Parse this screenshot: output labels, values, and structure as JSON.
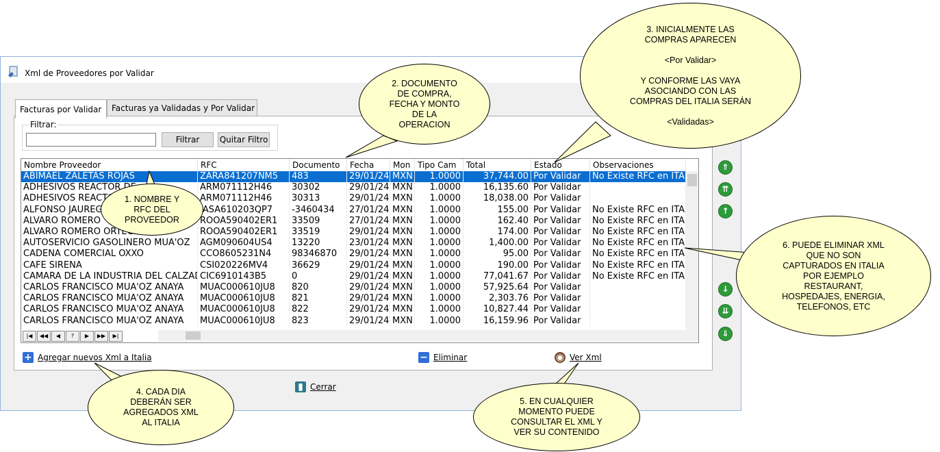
{
  "window": {
    "title": "Xml de Proveedores por Validar"
  },
  "tabs": [
    "Facturas por Validar",
    "Facturas ya Validadas y Por Validar"
  ],
  "filter": {
    "label": "Filtrar:",
    "value": "",
    "filter_btn": "Filtrar",
    "clear_btn": "Quitar Filtro"
  },
  "grid": {
    "columns": [
      "Nombre Proveedor",
      "RFC",
      "Documento",
      "Fecha",
      "Mon",
      "Tipo Cam",
      "Total",
      "Estado",
      "Observaciones"
    ],
    "rows": [
      [
        "ABIMAEL ZALETAS ROJAS",
        "ZARA841207NM5",
        "483",
        "29/01/24",
        "MXN",
        "1.0000",
        "37,744.00",
        "Por Validar",
        "No Existe RFC en ITA"
      ],
      [
        "ADHESIVOS REACTOR DE",
        "ARM071112H46",
        "30302",
        "29/01/24",
        "MXN",
        "1.0000",
        "16,135.60",
        "Por Validar",
        ""
      ],
      [
        "ADHESIVOS REACTOR",
        "ARM071112H46",
        "30313",
        "29/01/24",
        "MXN",
        "1.0000",
        "18,038.00",
        "Por Validar",
        ""
      ],
      [
        "ALFONSO JAUREGUI",
        "IASA610203QP7",
        "-3460434",
        "27/01/24",
        "MXN",
        "1.0000",
        "155.00",
        "Por Validar",
        "No Existe RFC en ITA"
      ],
      [
        "ALVARO ROMERO",
        "ROOA590402ER1",
        "33509",
        "27/01/24",
        "MXN",
        "1.0000",
        "162.40",
        "Por Validar",
        "No Existe RFC en ITA"
      ],
      [
        "ALVARO ROMERO ORTEGA",
        "ROOA590402ER1",
        "33519",
        "29/01/24",
        "MXN",
        "1.0000",
        "174.00",
        "Por Validar",
        "No Existe RFC en ITA"
      ],
      [
        "AUTOSERVICIO GASOLINERO MUÃ'OZ",
        "AGM090604US4",
        "13220",
        "23/01/24",
        "MXN",
        "1.0000",
        "1,400.00",
        "Por Validar",
        "No Existe RFC en ITA"
      ],
      [
        "CADENA COMERCIAL OXXO",
        "CCO8605231N4",
        "98346870",
        "29/01/24",
        "MXN",
        "1.0000",
        "95.00",
        "Por Validar",
        "No Existe RFC en ITA"
      ],
      [
        "CAFE SIRENA",
        "CSI020226MV4",
        "36629",
        "29/01/24",
        "MXN",
        "1.0000",
        "190.00",
        "Por Validar",
        "No Existe RFC en ITA"
      ],
      [
        "CAMARA DE LA INDUSTRIA DEL CALZADO",
        "CIC6910143B5",
        "0",
        "29/01/24",
        "MXN",
        "1.0000",
        "77,041.67",
        "Por Validar",
        "No Existe RFC en ITA"
      ],
      [
        "CARLOS FRANCISCO MUÃ'OZ ANAYA",
        "MUAC000610JU8",
        "820",
        "29/01/24",
        "MXN",
        "1.0000",
        "57,925.64",
        "Por Validar",
        ""
      ],
      [
        "CARLOS FRANCISCO MUÃ'OZ ANAYA",
        "MUAC000610JU8",
        "821",
        "29/01/24",
        "MXN",
        "1.0000",
        "2,303.76",
        "Por Validar",
        ""
      ],
      [
        "CARLOS FRANCISCO MUÃ'OZ ANAYA",
        "MUAC000610JU8",
        "822",
        "29/01/24",
        "MXN",
        "1.0000",
        "10,827.44",
        "Por Validar",
        ""
      ],
      [
        "CARLOS FRANCISCO MUÃ'OZ ANAYA",
        "MUAC000610JU8",
        "823",
        "29/01/24",
        "MXN",
        "1.0000",
        "16,159.96",
        "Por Validar",
        ""
      ]
    ]
  },
  "actions": {
    "add": "Agregar nuevos Xml a Italia",
    "delete": "Eliminar",
    "view": "Ver Xml",
    "close": "Cerrar"
  },
  "callouts": {
    "c1": "1. NOMBRE Y\nRFC DEL\nPROVEEDOR",
    "c2": "2. DOCUMENTO\nDE COMPRA,\nFECHA Y MONTO\nDE LA\nOPERACION",
    "c3": "3. INICIALMENTE LAS\nCOMPRAS APARECEN\n\n<Por Validar>\n\nY CONFORME LAS VAYA\nASOCIANDO CON LAS\nCOMPRAS DEL ITALIA SERÁN\n\n<Validadas>",
    "c4": "4. CADA DIA\nDEBERÁN SER\nAGREGADOS XML\nAL ITALIA",
    "c5": "5. EN CUALQUIER\nMOMENTO PUEDE\nCONSULTAR EL XML Y\nVER SU CONTENIDO",
    "c6": "6. PUEDE ELIMINAR XML\nQUE NO SON\nCAPTURADOS EN ITALIA\nPOR EJEMPLO\nRESTAURANT,\nHOSPEDAJES, ENERGIA,\nTELEFONOS, ETC"
  },
  "colors": {
    "accent": "#0a6ed1",
    "callout_fill": "#ffffcc",
    "side_buttons": "#2e9b3a"
  }
}
